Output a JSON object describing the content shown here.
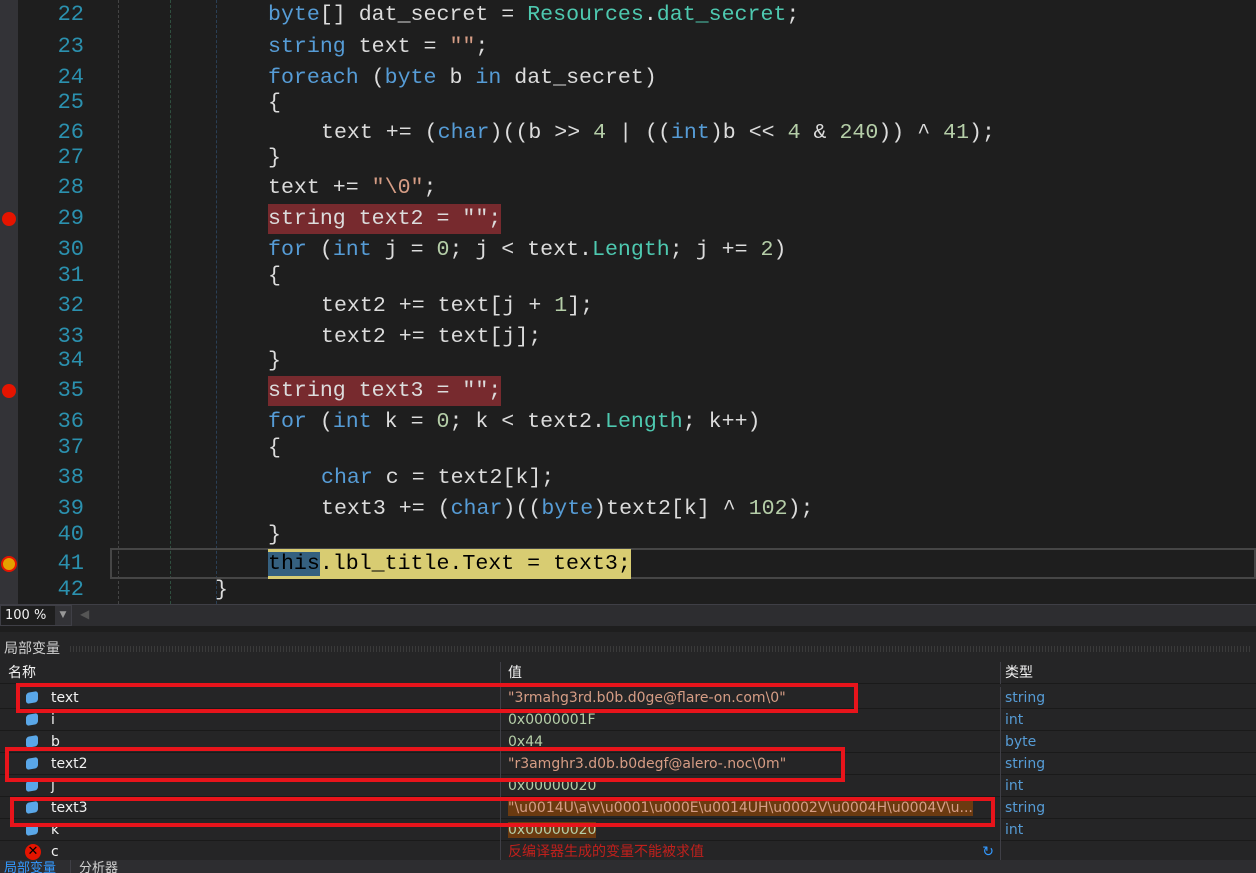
{
  "editor": {
    "breakpoint_lines": [
      29,
      35
    ],
    "current_line": 41,
    "lines": [
      {
        "n": "22",
        "indent": 0,
        "tokens": [
          [
            "byte",
            "kw"
          ],
          [
            "[] dat_secret = ",
            "txt"
          ],
          [
            "Resources",
            "ty"
          ],
          [
            ".",
            "txt"
          ],
          [
            "dat_secret",
            "ty"
          ],
          [
            ";",
            "txt"
          ]
        ]
      },
      {
        "n": "23",
        "indent": 0,
        "tokens": [
          [
            "string",
            "kw"
          ],
          [
            " text = ",
            "txt"
          ],
          [
            "\"\"",
            "str"
          ],
          [
            ";",
            "txt"
          ]
        ]
      },
      {
        "n": "24",
        "indent": 0,
        "tokens": [
          [
            "foreach",
            "kw"
          ],
          [
            " (",
            "txt"
          ],
          [
            "byte",
            "kw"
          ],
          [
            " b ",
            "txt"
          ],
          [
            "in",
            "kw"
          ],
          [
            " dat_secret)",
            "txt"
          ]
        ]
      },
      {
        "n": "25",
        "indent": 0,
        "tokens": [
          [
            "{",
            "txt"
          ]
        ]
      },
      {
        "n": "26",
        "indent": 1,
        "tokens": [
          [
            "text += (",
            "txt"
          ],
          [
            "char",
            "kw"
          ],
          [
            ")((b >> ",
            "txt"
          ],
          [
            "4",
            "num"
          ],
          [
            " | ((",
            "txt"
          ],
          [
            "int",
            "kw"
          ],
          [
            ")b << ",
            "txt"
          ],
          [
            "4",
            "num"
          ],
          [
            " & ",
            "txt"
          ],
          [
            "240",
            "num"
          ],
          [
            ")) ^ ",
            "txt"
          ],
          [
            "41",
            "num"
          ],
          [
            ");",
            "txt"
          ]
        ]
      },
      {
        "n": "27",
        "indent": 0,
        "tokens": [
          [
            "}",
            "txt"
          ]
        ]
      },
      {
        "n": "28",
        "indent": 0,
        "tokens": [
          [
            "text += ",
            "txt"
          ],
          [
            "\"\\0\"",
            "str"
          ],
          [
            ";",
            "txt"
          ]
        ]
      },
      {
        "n": "29",
        "indent": 0,
        "tokens": [
          [
            "string text2 = \"\";",
            "txt"
          ]
        ]
      },
      {
        "n": "30",
        "indent": 0,
        "tokens": [
          [
            "for",
            "kw"
          ],
          [
            " (",
            "txt"
          ],
          [
            "int",
            "kw"
          ],
          [
            " j = ",
            "txt"
          ],
          [
            "0",
            "num"
          ],
          [
            "; j < text.",
            "txt"
          ],
          [
            "Length",
            "ty"
          ],
          [
            "; j += ",
            "txt"
          ],
          [
            "2",
            "num"
          ],
          [
            ")",
            "txt"
          ]
        ]
      },
      {
        "n": "31",
        "indent": 0,
        "tokens": [
          [
            "{",
            "txt"
          ]
        ]
      },
      {
        "n": "32",
        "indent": 1,
        "tokens": [
          [
            "text2 += text[j + ",
            "txt"
          ],
          [
            "1",
            "num"
          ],
          [
            "];",
            "txt"
          ]
        ]
      },
      {
        "n": "33",
        "indent": 1,
        "tokens": [
          [
            "text2 += text[j];",
            "txt"
          ]
        ]
      },
      {
        "n": "34",
        "indent": 0,
        "tokens": [
          [
            "}",
            "txt"
          ]
        ]
      },
      {
        "n": "35",
        "indent": 0,
        "tokens": [
          [
            "string text3 = \"\";",
            "txt"
          ]
        ]
      },
      {
        "n": "36",
        "indent": 0,
        "tokens": [
          [
            "for",
            "kw"
          ],
          [
            " (",
            "txt"
          ],
          [
            "int",
            "kw"
          ],
          [
            " k = ",
            "txt"
          ],
          [
            "0",
            "num"
          ],
          [
            "; k < text2.",
            "txt"
          ],
          [
            "Length",
            "ty"
          ],
          [
            "; k++)",
            "txt"
          ]
        ]
      },
      {
        "n": "37",
        "indent": 0,
        "tokens": [
          [
            "{",
            "txt"
          ]
        ]
      },
      {
        "n": "38",
        "indent": 1,
        "tokens": [
          [
            "char",
            "kw"
          ],
          [
            " c = text2[k];",
            "txt"
          ]
        ]
      },
      {
        "n": "39",
        "indent": 1,
        "tokens": [
          [
            "text3 += (",
            "txt"
          ],
          [
            "char",
            "kw"
          ],
          [
            ")((",
            "txt"
          ],
          [
            "byte",
            "kw"
          ],
          [
            ")text2[k] ^ ",
            "txt"
          ],
          [
            "102",
            "num"
          ],
          [
            ");",
            "txt"
          ]
        ]
      },
      {
        "n": "40",
        "indent": 0,
        "tokens": [
          [
            "}",
            "txt"
          ]
        ]
      },
      {
        "n": "41",
        "indent": 0,
        "tokens": [
          [
            "this",
            "txt"
          ],
          [
            ".lbl_title.Text = text3;",
            "txt"
          ]
        ]
      },
      {
        "n": "42",
        "indent": -1,
        "tokens": [
          [
            "}",
            "txt"
          ]
        ]
      }
    ]
  },
  "zoom": {
    "level": "100 %"
  },
  "locals": {
    "title": "局部变量",
    "columns": {
      "name": "名称",
      "value": "值",
      "type": "类型"
    },
    "rows": [
      {
        "name": "text",
        "value": "\"3rmahg3rd.b0b.d0ge@flare-on.com\\0\"",
        "type": "string",
        "kind": "str",
        "highlight": true
      },
      {
        "name": "i",
        "value": "0x0000001F",
        "type": "int",
        "kind": "num"
      },
      {
        "name": "b",
        "value": "0x44",
        "type": "byte",
        "kind": "num"
      },
      {
        "name": "text2",
        "value": "\"r3amghr3.d0b.b0degf@alero-.noc\\0m\"",
        "type": "string",
        "kind": "str",
        "highlight": true
      },
      {
        "name": "j",
        "value": "0x00000020",
        "type": "int",
        "kind": "num"
      },
      {
        "name": "text3",
        "value": "\"\\u0014U\\a\\v\\u0001\\u000E\\u0014UH\\u0002V\\u0004H\\u0004V\\u...",
        "type": "string",
        "kind": "str",
        "highlight": true,
        "changed": true
      },
      {
        "name": "k",
        "value": "0x00000020",
        "type": "int",
        "kind": "num",
        "changed": true
      },
      {
        "name": "c",
        "value": "反编译器生成的变量不能被求值",
        "type": "",
        "kind": "err"
      }
    ]
  },
  "bottom_tabs": [
    {
      "label": "局部变量",
      "active": true
    },
    {
      "label": "分析器",
      "active": false
    }
  ],
  "colors": {
    "breakpoint": "#e51400",
    "highlight_box": "#e8141b",
    "keyword": "#569cd6",
    "type": "#4ec9b0",
    "string": "#d69d85",
    "number": "#b5cea8"
  }
}
